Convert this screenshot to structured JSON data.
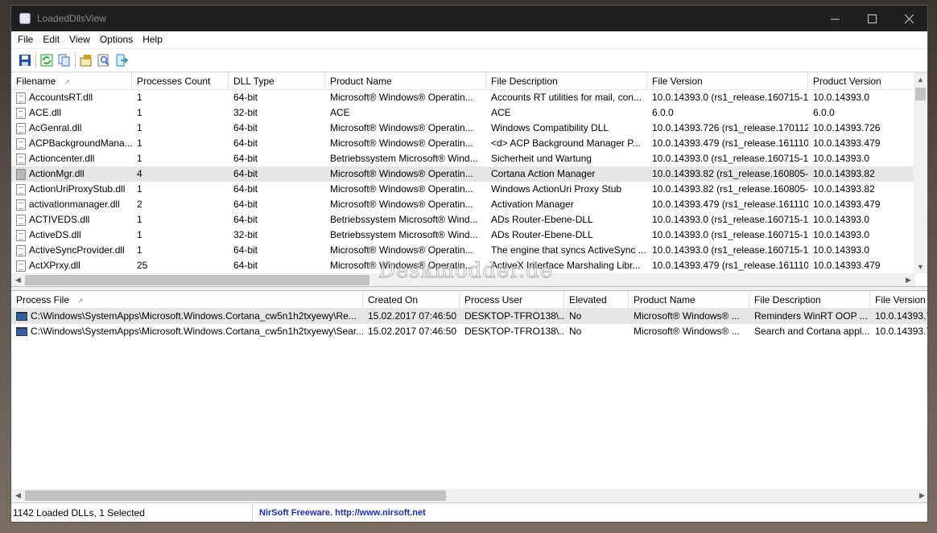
{
  "window": {
    "title": "LoadedDllsView"
  },
  "menu": [
    "File",
    "Edit",
    "View",
    "Options",
    "Help"
  ],
  "toolbar": [
    {
      "name": "save-icon",
      "color": "#1f4fa8"
    },
    {
      "name": "refresh-icon",
      "color": "#2a9a3a"
    },
    {
      "name": "copy-icon",
      "color": "#3a6ed8"
    },
    {
      "name": "properties-icon",
      "color": "#c9a020"
    },
    {
      "name": "find-icon",
      "color": "#3a6ed8"
    },
    {
      "name": "exit-icon",
      "color": "#2a8ab0"
    }
  ],
  "dll_table": {
    "columns": [
      {
        "label": "Filename",
        "sort": "↗",
        "w": 150
      },
      {
        "label": "Processes Count",
        "w": 120
      },
      {
        "label": "DLL Type",
        "w": 120
      },
      {
        "label": "Product Name",
        "w": 200
      },
      {
        "label": "File Description",
        "w": 200
      },
      {
        "label": "File Version",
        "w": 200
      },
      {
        "label": "Product Version",
        "w": 140
      }
    ],
    "rows": [
      [
        "AccountsRT.dll",
        "1",
        "64-bit",
        "Microsoft® Windows® Operatin...",
        "Accounts RT utilities for mail, con...",
        "10.0.14393.0 (rs1_release.160715-1...",
        "10.0.14393.0"
      ],
      [
        "ACE.dll",
        "1",
        "32-bit",
        "ACE",
        "ACE",
        "6.0.0",
        "6.0.0"
      ],
      [
        "AcGenral.dll",
        "1",
        "64-bit",
        "Microsoft® Windows® Operatin...",
        "Windows Compatibility DLL",
        "10.0.14393.726 (rs1_release.170112...",
        "10.0.14393.726"
      ],
      [
        "ACPBackgroundMana...",
        "1",
        "64-bit",
        "Microsoft® Windows® Operatin...",
        "<d> ACP Background Manager P...",
        "10.0.14393.479 (rs1_release.161110...",
        "10.0.14393.479"
      ],
      [
        "Actioncenter.dll",
        "1",
        "64-bit",
        "Betriebssystem Microsoft® Wind...",
        "Sicherheit und Wartung",
        "10.0.14393.0 (rs1_release.160715-1...",
        "10.0.14393.0"
      ],
      [
        "ActionMgr.dll",
        "4",
        "64-bit",
        "Microsoft® Windows® Operatin...",
        "Cortana Action Manager",
        "10.0.14393.82 (rs1_release.160805-...",
        "10.0.14393.82"
      ],
      [
        "ActionUriProxyStub.dll",
        "1",
        "64-bit",
        "Microsoft® Windows® Operatin...",
        "Windows ActionUri Proxy Stub",
        "10.0.14393.82 (rs1_release.160805-...",
        "10.0.14393.82"
      ],
      [
        "activationmanager.dll",
        "2",
        "64-bit",
        "Microsoft® Windows® Operatin...",
        "Activation Manager",
        "10.0.14393.479 (rs1_release.161110...",
        "10.0.14393.479"
      ],
      [
        "ACTIVEDS.dll",
        "1",
        "64-bit",
        "Betriebssystem Microsoft® Wind...",
        "ADs Router-Ebene-DLL",
        "10.0.14393.0 (rs1_release.160715-1...",
        "10.0.14393.0"
      ],
      [
        "ActiveDS.dll",
        "1",
        "32-bit",
        "Betriebssystem Microsoft® Wind...",
        "ADs Router-Ebene-DLL",
        "10.0.14393.0 (rs1_release.160715-1...",
        "10.0.14393.0"
      ],
      [
        "ActiveSyncProvider.dll",
        "1",
        "64-bit",
        "Microsoft® Windows® Operatin...",
        "The engine that syncs ActiveSync ...",
        "10.0.14393.0 (rs1_release.160715-1...",
        "10.0.14393.0"
      ],
      [
        "ActXPrxy.dll",
        "25",
        "64-bit",
        "Microsoft® Windows® Operatin...",
        "ActiveX Interface Marshaling Libr...",
        "10.0.14393.479 (rs1_release.161110...",
        "10.0.14393.479"
      ]
    ],
    "selected_index": 5
  },
  "process_table": {
    "columns": [
      {
        "label": "Process File",
        "sort": "↗",
        "w": 437
      },
      {
        "label": "Created On",
        "w": 120
      },
      {
        "label": "Process User",
        "w": 130
      },
      {
        "label": "Elevated",
        "w": 80
      },
      {
        "label": "Product Name",
        "w": 150
      },
      {
        "label": "File Description",
        "w": 150
      },
      {
        "label": "File Version",
        "w": 80
      }
    ],
    "rows": [
      [
        "C:\\Windows\\SystemApps\\Microsoft.Windows.Cortana_cw5n1h2txyewy\\Re...",
        "15.02.2017 07:46:50",
        "DESKTOP-TFRO138\\...",
        "No",
        "Microsoft® Windows® ...",
        "Reminders WinRT OOP ...",
        "10.0.14393.7..."
      ],
      [
        "C:\\Windows\\SystemApps\\Microsoft.Windows.Cortana_cw5n1h2txyewy\\Sear...",
        "15.02.2017 07:46:50",
        "DESKTOP-TFRO138\\...",
        "No",
        "Microsoft® Windows® ...",
        "Search and Cortana appl...",
        "10.0.14393.7..."
      ]
    ],
    "selected_index": 0
  },
  "status": {
    "left": "1142 Loaded DLLs, 1 Selected",
    "right": "NirSoft Freeware.  http://www.nirsoft.net"
  },
  "watermark": "Deskmodder.de"
}
